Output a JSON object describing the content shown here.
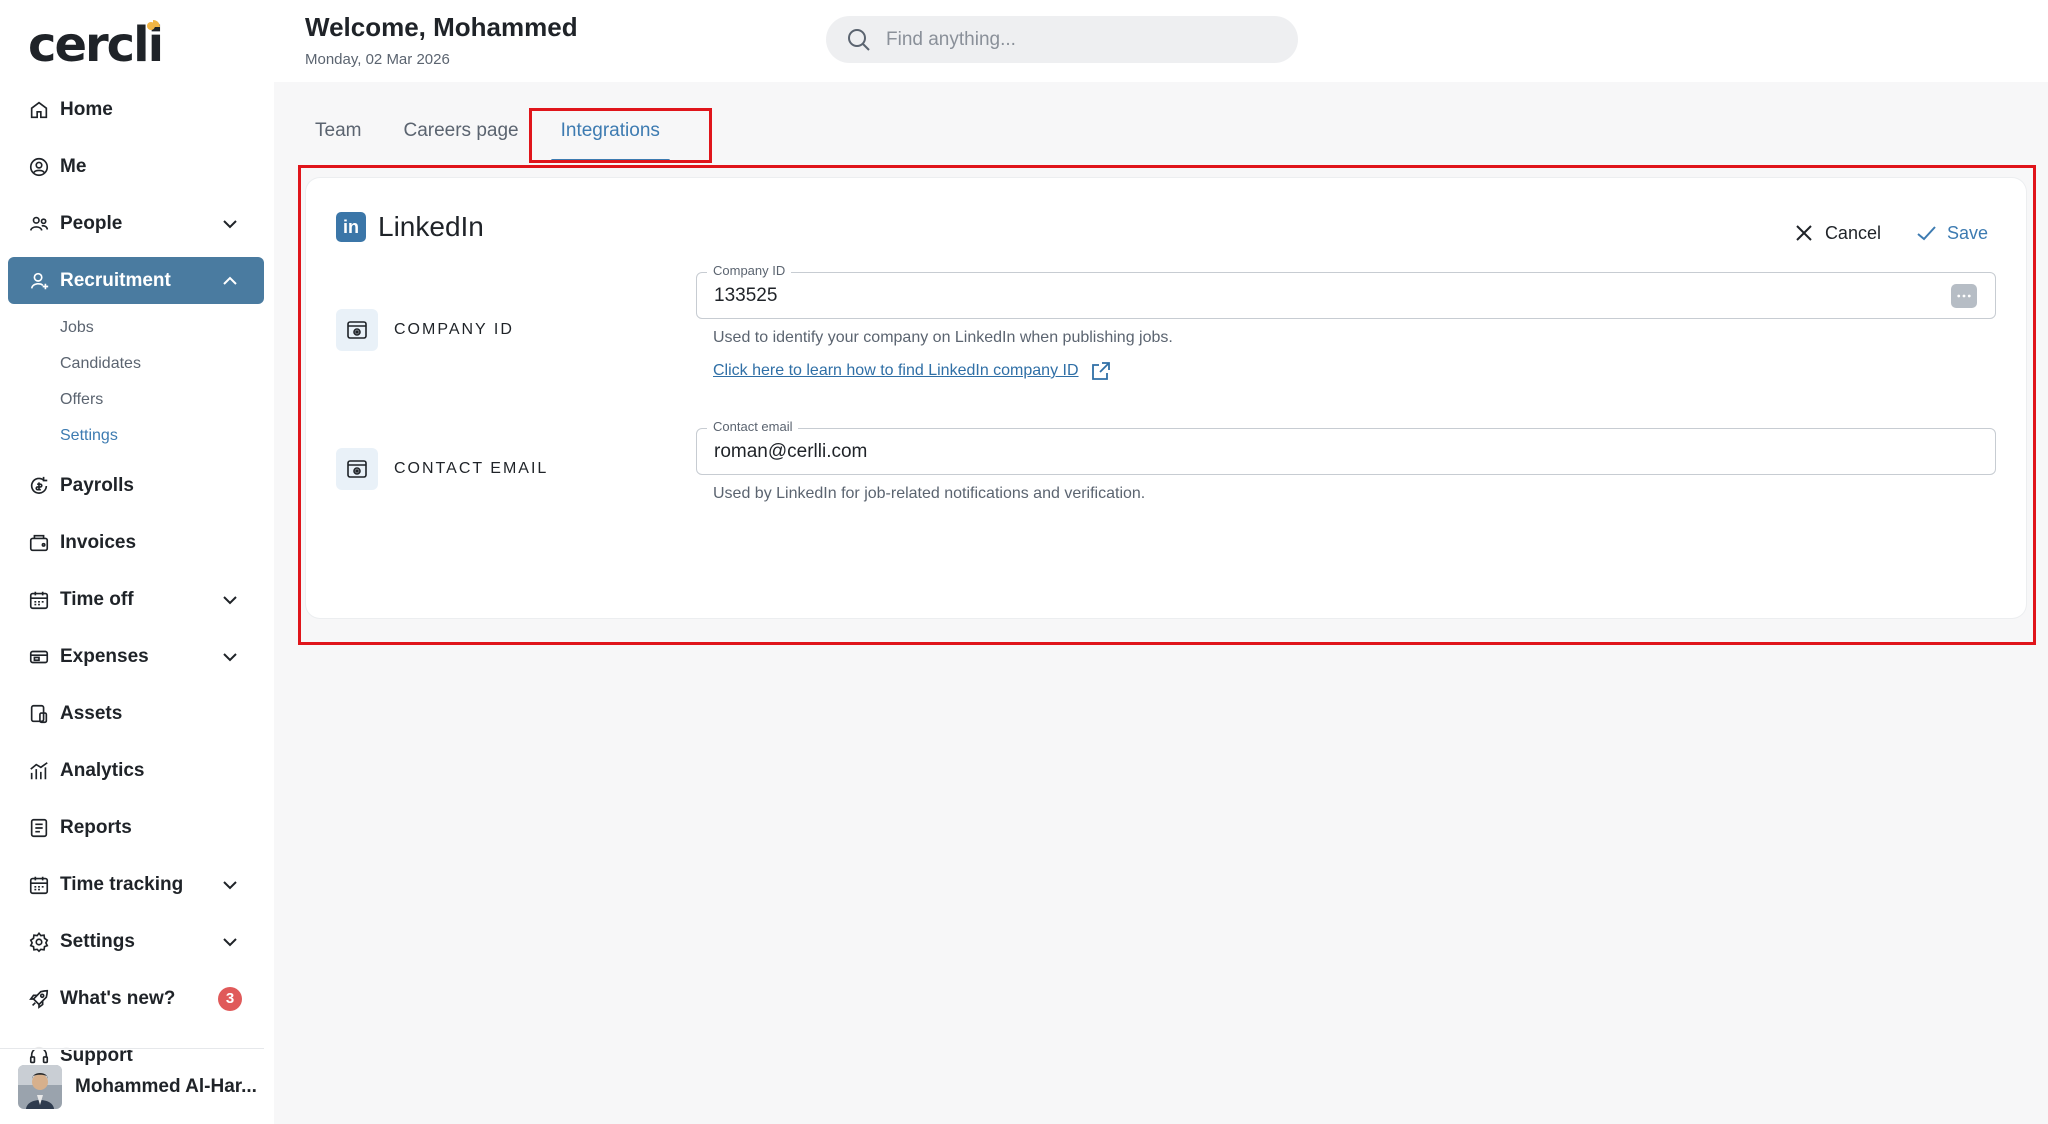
{
  "brand": {
    "name": "cercli",
    "accent": "#f2b544"
  },
  "header": {
    "welcome": "Welcome, Mohammed",
    "date": "Monday, 02 Mar 2026",
    "search_placeholder": "Find anything..."
  },
  "sidebar": {
    "items": [
      {
        "label": "Home",
        "icon": "home-icon"
      },
      {
        "label": "Me",
        "icon": "user-circle-icon"
      },
      {
        "label": "People",
        "icon": "people-icon",
        "expandable": true
      },
      {
        "label": "Recruitment",
        "icon": "recruitment-icon",
        "expandable": true,
        "active": true,
        "children": [
          "Jobs",
          "Candidates",
          "Offers",
          "Settings"
        ],
        "selected_child": "Settings"
      },
      {
        "label": "Payrolls",
        "icon": "payroll-icon"
      },
      {
        "label": "Invoices",
        "icon": "invoice-icon"
      },
      {
        "label": "Time off",
        "icon": "calendar-icon",
        "expandable": true
      },
      {
        "label": "Expenses",
        "icon": "expenses-icon",
        "expandable": true
      },
      {
        "label": "Assets",
        "icon": "assets-icon"
      },
      {
        "label": "Analytics",
        "icon": "analytics-icon"
      },
      {
        "label": "Reports",
        "icon": "reports-icon"
      },
      {
        "label": "Time tracking",
        "icon": "calendar-icon",
        "expandable": true
      },
      {
        "label": "Settings",
        "icon": "gear-icon",
        "expandable": true
      },
      {
        "label": "What's new?",
        "icon": "rocket-icon",
        "badge": "3"
      },
      {
        "label": "Support",
        "icon": "support-icon"
      }
    ],
    "user_name": "Mohammed Al-Har..."
  },
  "tabs": [
    {
      "label": "Team"
    },
    {
      "label": "Careers page"
    },
    {
      "label": "Integrations",
      "active": true
    }
  ],
  "integration": {
    "title": "LinkedIn",
    "logo_text": "in",
    "cancel_label": "Cancel",
    "save_label": "Save",
    "company_id": {
      "row_label": "COMPANY ID",
      "legend": "Company ID",
      "value": "133525",
      "help": "Used to identify your company on LinkedIn when publishing jobs.",
      "link": "Click here to learn how to find LinkedIn company ID"
    },
    "contact_email": {
      "row_label": "CONTACT EMAIL",
      "legend": "Contact email",
      "value": "roman@cerlli.com",
      "help": "Used by LinkedIn for job-related notifications and verification."
    }
  },
  "colors": {
    "primary": "#4a7ba0",
    "link": "#3d7bb1",
    "highlight": "#e0151b",
    "badge": "#e05a5a"
  }
}
